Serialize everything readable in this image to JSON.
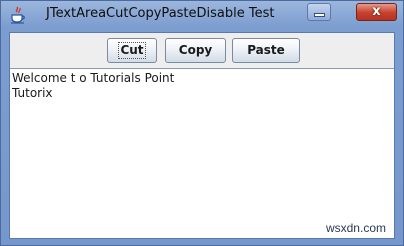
{
  "window": {
    "title": "JTextAreaCutCopyPasteDisable Test",
    "close_glyph": "x",
    "minimize_glyph": "_"
  },
  "toolbar": {
    "cut_label": "Cut",
    "copy_label": "Copy",
    "paste_label": "Paste"
  },
  "textarea": {
    "lines": [
      "Welcome t o Tutorials Point",
      "Tutorix"
    ]
  },
  "watermark": "wsxdn.com",
  "icons": {
    "app": "java-cup-icon",
    "minimize": "minimize-icon",
    "close": "close-icon"
  },
  "colors": {
    "titlebar": "#7c9dd0",
    "close_button": "#c6402d",
    "panel": "#eeeeee",
    "text_area": "#ffffff"
  }
}
